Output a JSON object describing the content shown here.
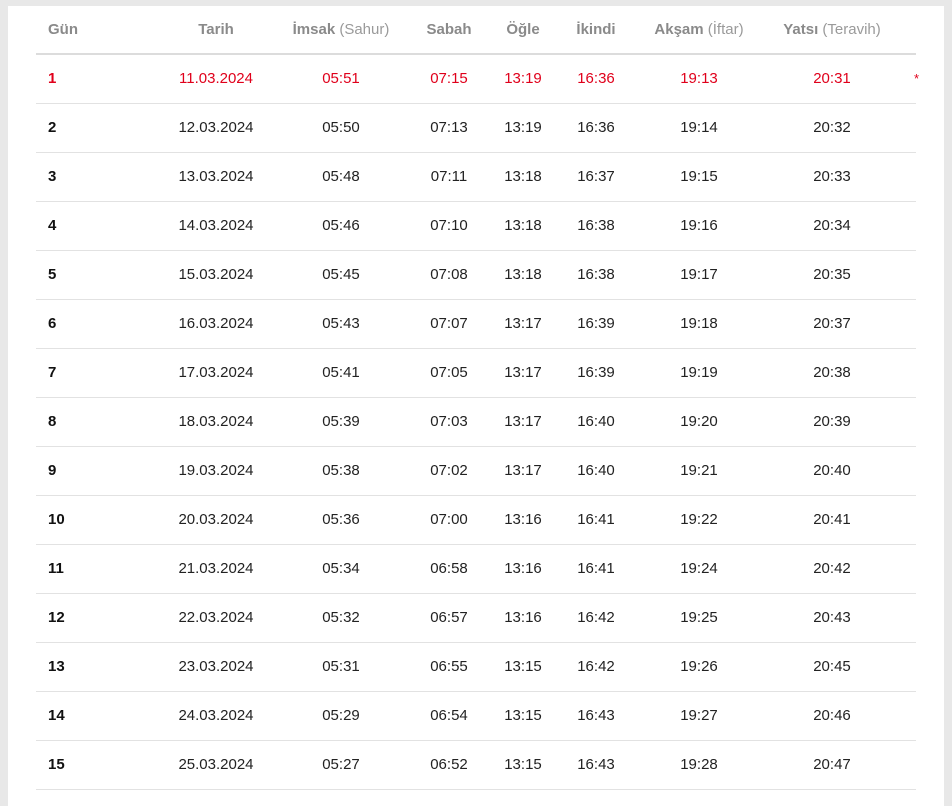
{
  "colors": {
    "today_accent": "#e0001b",
    "header_text": "#8a8a8a"
  },
  "headers": {
    "gun": "Gün",
    "tarih": "Tarih",
    "imsak": "İmsak",
    "imsak_sub": "(Sahur)",
    "sabah": "Sabah",
    "ogle": "Öğle",
    "ikindi": "İkindi",
    "aksam": "Akşam",
    "aksam_sub": "(İftar)",
    "yatsi": "Yatsı",
    "yatsi_sub": "(Teravih)"
  },
  "today_marker": "*",
  "rows": [
    {
      "gun": "1",
      "tarih": "11.03.2024",
      "imsak": "05:51",
      "sabah": "07:15",
      "ogle": "13:19",
      "ikindi": "16:36",
      "aksam": "19:13",
      "yatsi": "20:31",
      "today": true
    },
    {
      "gun": "2",
      "tarih": "12.03.2024",
      "imsak": "05:50",
      "sabah": "07:13",
      "ogle": "13:19",
      "ikindi": "16:36",
      "aksam": "19:14",
      "yatsi": "20:32"
    },
    {
      "gun": "3",
      "tarih": "13.03.2024",
      "imsak": "05:48",
      "sabah": "07:11",
      "ogle": "13:18",
      "ikindi": "16:37",
      "aksam": "19:15",
      "yatsi": "20:33"
    },
    {
      "gun": "4",
      "tarih": "14.03.2024",
      "imsak": "05:46",
      "sabah": "07:10",
      "ogle": "13:18",
      "ikindi": "16:38",
      "aksam": "19:16",
      "yatsi": "20:34"
    },
    {
      "gun": "5",
      "tarih": "15.03.2024",
      "imsak": "05:45",
      "sabah": "07:08",
      "ogle": "13:18",
      "ikindi": "16:38",
      "aksam": "19:17",
      "yatsi": "20:35"
    },
    {
      "gun": "6",
      "tarih": "16.03.2024",
      "imsak": "05:43",
      "sabah": "07:07",
      "ogle": "13:17",
      "ikindi": "16:39",
      "aksam": "19:18",
      "yatsi": "20:37"
    },
    {
      "gun": "7",
      "tarih": "17.03.2024",
      "imsak": "05:41",
      "sabah": "07:05",
      "ogle": "13:17",
      "ikindi": "16:39",
      "aksam": "19:19",
      "yatsi": "20:38"
    },
    {
      "gun": "8",
      "tarih": "18.03.2024",
      "imsak": "05:39",
      "sabah": "07:03",
      "ogle": "13:17",
      "ikindi": "16:40",
      "aksam": "19:20",
      "yatsi": "20:39"
    },
    {
      "gun": "9",
      "tarih": "19.03.2024",
      "imsak": "05:38",
      "sabah": "07:02",
      "ogle": "13:17",
      "ikindi": "16:40",
      "aksam": "19:21",
      "yatsi": "20:40"
    },
    {
      "gun": "10",
      "tarih": "20.03.2024",
      "imsak": "05:36",
      "sabah": "07:00",
      "ogle": "13:16",
      "ikindi": "16:41",
      "aksam": "19:22",
      "yatsi": "20:41"
    },
    {
      "gun": "11",
      "tarih": "21.03.2024",
      "imsak": "05:34",
      "sabah": "06:58",
      "ogle": "13:16",
      "ikindi": "16:41",
      "aksam": "19:24",
      "yatsi": "20:42"
    },
    {
      "gun": "12",
      "tarih": "22.03.2024",
      "imsak": "05:32",
      "sabah": "06:57",
      "ogle": "13:16",
      "ikindi": "16:42",
      "aksam": "19:25",
      "yatsi": "20:43"
    },
    {
      "gun": "13",
      "tarih": "23.03.2024",
      "imsak": "05:31",
      "sabah": "06:55",
      "ogle": "13:15",
      "ikindi": "16:42",
      "aksam": "19:26",
      "yatsi": "20:45"
    },
    {
      "gun": "14",
      "tarih": "24.03.2024",
      "imsak": "05:29",
      "sabah": "06:54",
      "ogle": "13:15",
      "ikindi": "16:43",
      "aksam": "19:27",
      "yatsi": "20:46"
    },
    {
      "gun": "15",
      "tarih": "25.03.2024",
      "imsak": "05:27",
      "sabah": "06:52",
      "ogle": "13:15",
      "ikindi": "16:43",
      "aksam": "19:28",
      "yatsi": "20:47"
    }
  ]
}
